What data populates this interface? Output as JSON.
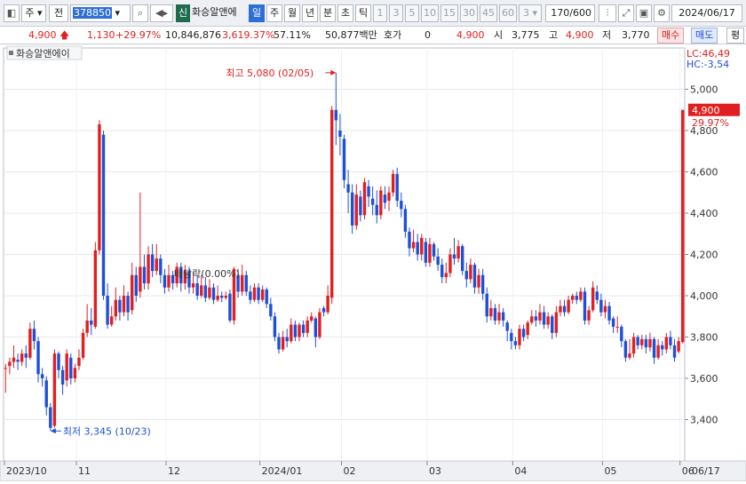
{
  "toolbar": {
    "market": "주",
    "all": "전",
    "code": "378850",
    "badge": "신",
    "name": "화승알앤에",
    "periods": [
      "일",
      "주",
      "월",
      "년",
      "분",
      "초",
      "틱"
    ],
    "minute_options": [
      "1",
      "3",
      "5",
      "10",
      "15",
      "30",
      "45",
      "60"
    ],
    "minute_value": "3",
    "count": "170",
    "count_max": "/600",
    "date": "2024/06/17"
  },
  "quote": {
    "price": "4,900",
    "change": "1,130",
    "change_pct": "+29.97%",
    "volume": "10,846,876",
    "volume_pct": "3,619.37%",
    "turnover": "57.11%",
    "amount": "50,877백만",
    "hoga_label": "호가",
    "hoga_value": "0",
    "ask_price": "4,900",
    "open_label": "시",
    "open": "3,775",
    "high_label": "고",
    "high": "4,900",
    "low_label": "저",
    "low": "3,770",
    "buy_label": "매수",
    "sell_label": "매도",
    "more_label": "평"
  },
  "chart_data": {
    "type": "candlestick",
    "title": "화승알앤에이",
    "ylim": [
      3200,
      5200
    ],
    "y_ticks": [
      "3,400",
      "3,600",
      "3,800",
      "4,000",
      "4,200",
      "4,400",
      "4,600",
      "4,800",
      "5,000"
    ],
    "x_tick_labels": [
      "2023/10",
      "11",
      "12",
      "2024/01",
      "02",
      "03",
      "04",
      "05",
      "06",
      "06/17"
    ],
    "lc": "LC:46,49",
    "hc": "HC:-3,54",
    "last_price": "4,900",
    "last_pct": "29.97%",
    "high_annotation": "최고 5,080 (02/05)",
    "low_annotation": "최저 3,345 (10/23)",
    "dividend_annotation": "배당락(0.00%)",
    "candles": [
      [
        3650,
        3650,
        3530,
        3670
      ],
      [
        3660,
        3680,
        3620,
        3700
      ],
      [
        3680,
        3700,
        3650,
        3760
      ],
      [
        3690,
        3680,
        3640,
        3720
      ],
      [
        3680,
        3720,
        3660,
        3740
      ],
      [
        3720,
        3700,
        3650,
        3760
      ],
      [
        3700,
        3840,
        3690,
        3870
      ],
      [
        3840,
        3780,
        3740,
        3880
      ],
      [
        3780,
        3620,
        3580,
        3800
      ],
      [
        3620,
        3600,
        3560,
        3650
      ],
      [
        3590,
        3460,
        3420,
        3610
      ],
      [
        3460,
        3360,
        3345,
        3480
      ],
      [
        3370,
        3720,
        3360,
        3740
      ],
      [
        3720,
        3640,
        3600,
        3730
      ],
      [
        3640,
        3570,
        3520,
        3660
      ],
      [
        3590,
        3720,
        3560,
        3740
      ],
      [
        3700,
        3600,
        3570,
        3720
      ],
      [
        3600,
        3650,
        3580,
        3670
      ],
      [
        3660,
        3700,
        3640,
        3740
      ],
      [
        3700,
        3820,
        3690,
        3840
      ],
      [
        3820,
        3880,
        3800,
        3960
      ],
      [
        3880,
        3860,
        3810,
        3940
      ],
      [
        3850,
        4220,
        3840,
        4260
      ],
      [
        4220,
        4830,
        4200,
        4850
      ],
      [
        4780,
        4000,
        3980,
        4800
      ],
      [
        4000,
        3860,
        3840,
        4060
      ],
      [
        3860,
        3900,
        3850,
        3950
      ],
      [
        3900,
        3980,
        3880,
        4040
      ],
      [
        3980,
        3920,
        3880,
        4000
      ],
      [
        3920,
        4000,
        3900,
        4050
      ],
      [
        4000,
        3920,
        3880,
        4020
      ],
      [
        3930,
        4100,
        3910,
        4160
      ],
      [
        4100,
        4000,
        3970,
        4140
      ],
      [
        4020,
        4140,
        3990,
        4500
      ],
      [
        4140,
        4060,
        4030,
        4200
      ],
      [
        4060,
        4200,
        4030,
        4240
      ],
      [
        4200,
        4120,
        4090,
        4250
      ],
      [
        4120,
        4180,
        4100,
        4250
      ],
      [
        4180,
        4100,
        4060,
        4200
      ],
      [
        4100,
        4040,
        4010,
        4130
      ],
      [
        4040,
        4100,
        4020,
        4150
      ],
      [
        4100,
        4060,
        4030,
        4120
      ],
      [
        4060,
        4140,
        4040,
        4160
      ],
      [
        4140,
        4060,
        4020,
        4160
      ],
      [
        4060,
        4120,
        4030,
        4150
      ],
      [
        4120,
        4040,
        4010,
        4140
      ],
      [
        4040,
        4060,
        4010,
        4110
      ],
      [
        4060,
        4000,
        3980,
        4100
      ],
      [
        4000,
        4050,
        3990,
        4100
      ],
      [
        4050,
        3990,
        3970,
        4090
      ],
      [
        3990,
        4040,
        3980,
        4080
      ],
      [
        4040,
        3980,
        3960,
        4060
      ],
      [
        3980,
        4000,
        3970,
        4050
      ],
      [
        4000,
        3990,
        3970,
        4020
      ],
      [
        3990,
        4000,
        3980,
        4020
      ],
      [
        4010,
        3880,
        3870,
        4030
      ],
      [
        3880,
        4130,
        3860,
        4140
      ],
      [
        4100,
        4020,
        3990,
        4130
      ],
      [
        4020,
        4100,
        4000,
        4150
      ],
      [
        4100,
        4020,
        4000,
        4120
      ],
      [
        4020,
        3980,
        3960,
        4050
      ],
      [
        3980,
        4040,
        3970,
        4060
      ],
      [
        4040,
        3980,
        3960,
        4060
      ],
      [
        3980,
        4030,
        3970,
        4050
      ],
      [
        4030,
        3960,
        3940,
        4040
      ],
      [
        3960,
        3900,
        3880,
        3990
      ],
      [
        3900,
        3800,
        3780,
        3920
      ],
      [
        3800,
        3740,
        3720,
        3820
      ],
      [
        3740,
        3800,
        3730,
        3830
      ],
      [
        3800,
        3780,
        3750,
        3840
      ],
      [
        3780,
        3860,
        3770,
        3890
      ],
      [
        3860,
        3800,
        3780,
        3880
      ],
      [
        3800,
        3860,
        3780,
        3870
      ],
      [
        3860,
        3820,
        3800,
        3880
      ],
      [
        3820,
        3880,
        3800,
        3900
      ],
      [
        3880,
        3900,
        3870,
        3920
      ],
      [
        3890,
        3800,
        3750,
        3900
      ],
      [
        3800,
        3920,
        3790,
        3940
      ],
      [
        3940,
        3920,
        3900,
        3950
      ],
      [
        3920,
        4000,
        3910,
        4050
      ],
      [
        3990,
        4900,
        3960,
        4920
      ],
      [
        4900,
        4850,
        4730,
        5080
      ],
      [
        4800,
        4770,
        4680,
        4880
      ],
      [
        4760,
        4560,
        4520,
        4780
      ],
      [
        4540,
        4500,
        4400,
        4610
      ],
      [
        4500,
        4340,
        4300,
        4540
      ],
      [
        4340,
        4490,
        4320,
        4540
      ],
      [
        4480,
        4390,
        4360,
        4510
      ],
      [
        4390,
        4550,
        4370,
        4570
      ],
      [
        4530,
        4480,
        4430,
        4560
      ],
      [
        4470,
        4440,
        4390,
        4530
      ],
      [
        4440,
        4390,
        4350,
        4510
      ],
      [
        4390,
        4510,
        4370,
        4530
      ],
      [
        4490,
        4450,
        4420,
        4530
      ],
      [
        4460,
        4500,
        4410,
        4530
      ],
      [
        4500,
        4590,
        4480,
        4610
      ],
      [
        4590,
        4460,
        4430,
        4620
      ],
      [
        4460,
        4420,
        4380,
        4500
      ],
      [
        4420,
        4310,
        4280,
        4440
      ],
      [
        4310,
        4230,
        4190,
        4330
      ],
      [
        4230,
        4260,
        4210,
        4320
      ],
      [
        4260,
        4200,
        4170,
        4300
      ],
      [
        4200,
        4280,
        4170,
        4300
      ],
      [
        4260,
        4160,
        4140,
        4280
      ],
      [
        4160,
        4250,
        4140,
        4280
      ],
      [
        4250,
        4190,
        4170,
        4260
      ],
      [
        4190,
        4150,
        4120,
        4230
      ],
      [
        4150,
        4090,
        4060,
        4180
      ],
      [
        4090,
        4110,
        4060,
        4160
      ],
      [
        4110,
        4200,
        4090,
        4230
      ],
      [
        4200,
        4180,
        4150,
        4280
      ],
      [
        4180,
        4240,
        4160,
        4270
      ],
      [
        4240,
        4120,
        4100,
        4250
      ],
      [
        4120,
        4080,
        4040,
        4160
      ],
      [
        4080,
        4150,
        4060,
        4180
      ],
      [
        4150,
        4040,
        4010,
        4160
      ],
      [
        4040,
        4100,
        4010,
        4130
      ],
      [
        4100,
        4010,
        3980,
        4130
      ],
      [
        4010,
        3900,
        3870,
        4040
      ],
      [
        3900,
        3940,
        3880,
        3980
      ],
      [
        3940,
        3880,
        3860,
        3960
      ],
      [
        3880,
        3920,
        3860,
        3960
      ],
      [
        3920,
        3880,
        3850,
        3940
      ],
      [
        3870,
        3830,
        3780,
        3880
      ],
      [
        3820,
        3780,
        3740,
        3840
      ],
      [
        3780,
        3760,
        3740,
        3800
      ],
      [
        3760,
        3840,
        3740,
        3860
      ],
      [
        3840,
        3800,
        3780,
        3860
      ],
      [
        3810,
        3870,
        3790,
        3880
      ],
      [
        3870,
        3900,
        3860,
        3930
      ],
      [
        3900,
        3880,
        3850,
        3930
      ],
      [
        3880,
        3920,
        3860,
        3960
      ],
      [
        3920,
        3860,
        3840,
        3950
      ],
      [
        3860,
        3900,
        3840,
        3920
      ],
      [
        3900,
        3820,
        3790,
        3910
      ],
      [
        3820,
        3920,
        3800,
        3950
      ],
      [
        3920,
        3950,
        3900,
        3980
      ],
      [
        3950,
        3920,
        3900,
        3980
      ],
      [
        3920,
        3980,
        3910,
        4000
      ],
      [
        3980,
        4000,
        3960,
        4010
      ],
      [
        4000,
        3980,
        3960,
        4020
      ],
      [
        3980,
        4020,
        3970,
        4040
      ],
      [
        4020,
        3880,
        3860,
        4040
      ],
      [
        3880,
        3930,
        3860,
        3950
      ],
      [
        3930,
        4040,
        3920,
        4070
      ],
      [
        4020,
        3980,
        3960,
        4050
      ],
      [
        3980,
        3920,
        3900,
        4010
      ],
      [
        3920,
        3950,
        3890,
        3980
      ],
      [
        3950,
        3880,
        3860,
        3970
      ],
      [
        3890,
        3850,
        3820,
        3900
      ],
      [
        3850,
        3850,
        3820,
        3900
      ],
      [
        3850,
        3780,
        3750,
        3860
      ],
      [
        3780,
        3700,
        3680,
        3790
      ],
      [
        3700,
        3720,
        3690,
        3790
      ],
      [
        3720,
        3800,
        3700,
        3820
      ],
      [
        3800,
        3760,
        3740,
        3810
      ],
      [
        3760,
        3790,
        3740,
        3810
      ],
      [
        3790,
        3750,
        3720,
        3810
      ],
      [
        3750,
        3790,
        3730,
        3820
      ],
      [
        3790,
        3700,
        3670,
        3800
      ],
      [
        3700,
        3760,
        3690,
        3790
      ],
      [
        3760,
        3740,
        3710,
        3780
      ],
      [
        3740,
        3800,
        3720,
        3820
      ],
      [
        3800,
        3760,
        3740,
        3830
      ],
      [
        3760,
        3700,
        3680,
        3790
      ],
      [
        3730,
        3780,
        3720,
        3800
      ],
      [
        3775,
        4900,
        3770,
        4900
      ]
    ]
  }
}
